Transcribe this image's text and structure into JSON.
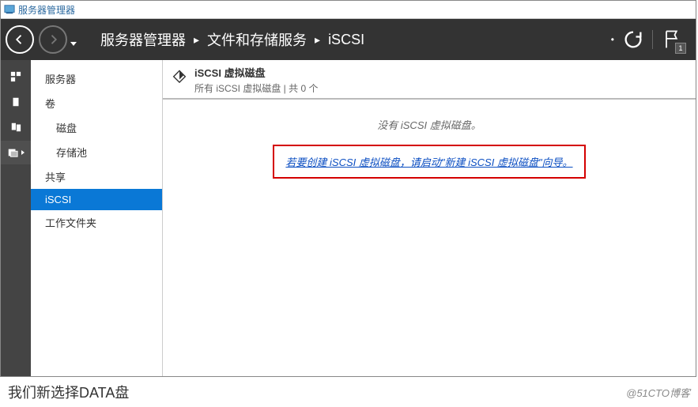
{
  "window": {
    "title": "服务器管理器"
  },
  "breadcrumbs": {
    "a": "服务器管理器",
    "b": "文件和存储服务",
    "c": "iSCSI"
  },
  "notif": {
    "count": "1"
  },
  "sidenav": {
    "items": [
      {
        "label": "服务器"
      },
      {
        "label": "卷"
      },
      {
        "label": "磁盘"
      },
      {
        "label": "存储池"
      },
      {
        "label": "共享"
      },
      {
        "label": "iSCSI"
      },
      {
        "label": "工作文件夹"
      }
    ]
  },
  "panel": {
    "title": "iSCSI 虚拟磁盘",
    "subtitle": "所有 iSCSI 虚拟磁盘 | 共 0 个",
    "none_text": "没有 iSCSI 虚拟磁盘。",
    "wizard_link": "若要创建 iSCSI 虚拟磁盘，请启动\"新建 iSCSI 虚拟磁盘\"向导。"
  },
  "caption": {
    "text": "我们新选择DATA盘",
    "watermark": "@51CTO博客"
  }
}
